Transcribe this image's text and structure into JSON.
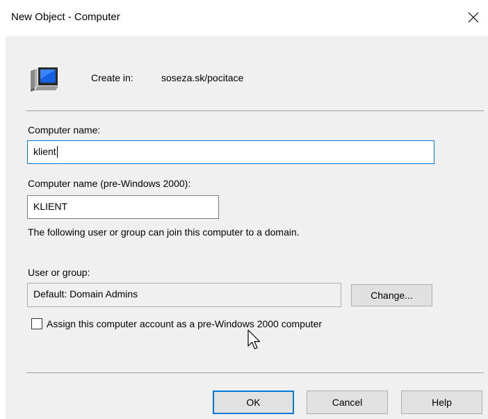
{
  "window": {
    "title": "New Object - Computer"
  },
  "header": {
    "create_in_label": "Create in:",
    "create_in_path": "soseza.sk/pocitace",
    "icon": "computer-icon"
  },
  "form": {
    "computer_name_label": "Computer name:",
    "computer_name_value": "klient",
    "computer_name_pre2000_label": "Computer name (pre-Windows 2000):",
    "computer_name_pre2000_value": "KLIENT",
    "join_info": "The following user or group can join this computer to a domain.",
    "user_group_label": "User or group:",
    "user_group_value": "Default: Domain Admins",
    "change_button": "Change...",
    "checkbox_label": "Assign this computer account as a pre-Windows 2000 computer",
    "checkbox_checked": false
  },
  "footer": {
    "ok": "OK",
    "cancel": "Cancel",
    "help": "Help"
  },
  "colors": {
    "focus_border": "#0078d7",
    "dialog_bg": "#f0f0f0"
  }
}
